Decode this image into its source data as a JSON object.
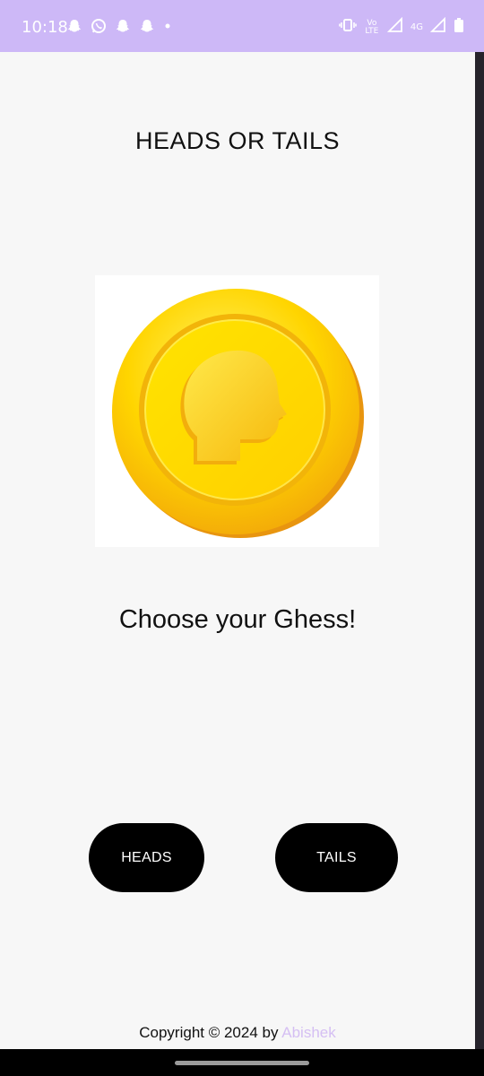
{
  "status_bar": {
    "time": "10:18",
    "left_icons": [
      "snapchat-icon",
      "whatsapp-icon",
      "snapchat-icon",
      "snapchat-icon",
      "dot-icon"
    ],
    "right_icons": [
      "vibrate-icon",
      "volte-icon",
      "signal-icon",
      "4g-icon",
      "signal-icon",
      "battery-icon"
    ],
    "volte_label": "Vo LTE",
    "network_label": "4G"
  },
  "app": {
    "title": "HEADS OR TAILS",
    "prompt": "Choose your Ghess!",
    "heads_label": "HEADS",
    "tails_label": "TAILS",
    "footer_prefix": "Copyright © 2024 by ",
    "footer_author": "Abishek"
  },
  "colors": {
    "status_bar": "#cdb8f7",
    "background": "#f7f7f7",
    "button": "#000000",
    "author_link": "#d5bff3",
    "coin_gold": "#ffd500"
  }
}
